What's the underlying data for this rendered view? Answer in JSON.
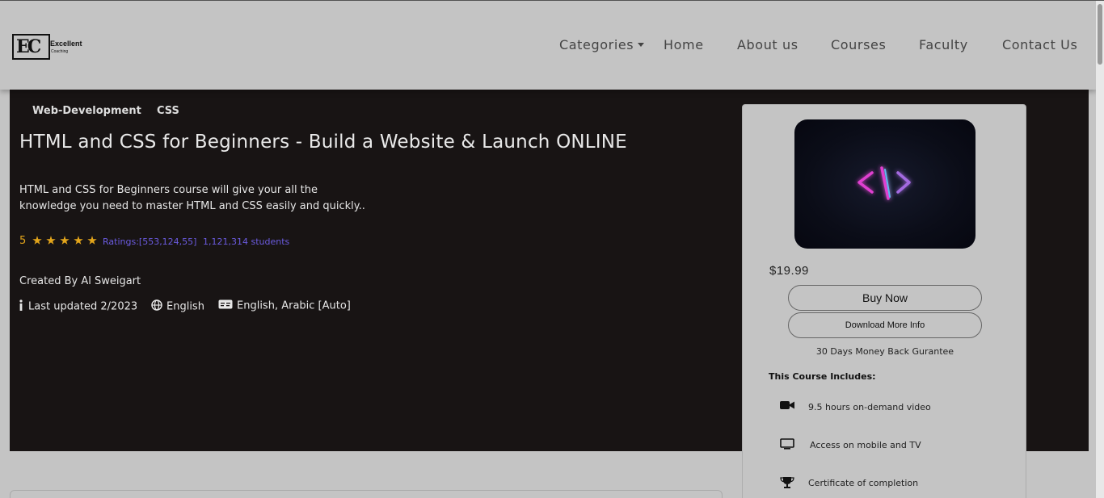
{
  "brand": {
    "logo_mark": "EC",
    "logo_title": "Excellent",
    "logo_subtitle": "Coaching"
  },
  "nav": {
    "categories": "Categories",
    "home": "Home",
    "about": "About us",
    "courses": "Courses",
    "faculty": "Faculty",
    "contact": "Contact Us"
  },
  "course": {
    "tags": [
      "Web-Development",
      "CSS"
    ],
    "title": "HTML and CSS for Beginners - Build a Website & Launch ONLINE",
    "description": "HTML and CSS for Beginners course will give your all the knowledge you need to master HTML and CSS easily and quickly..",
    "rating": "5",
    "stars": 5,
    "ratings_count": "Ratings:[553,124,55]",
    "students": "1,121,314 students",
    "creator": "Created By Al Sweigart",
    "last_updated": "Last updated 2/2023",
    "language": "English",
    "captions": "English, Arabic [Auto]"
  },
  "sidebar": {
    "thumbnail_icon": "code-brackets-icon",
    "price": "$19.99",
    "buy_label": "Buy Now",
    "info_label": "Download More Info",
    "guarantee": "30 Days Money Back Gurantee",
    "includes_title": "This Course Includes:",
    "includes": [
      {
        "icon": "video-camera-icon",
        "label": "9.5 hours on-demand video"
      },
      {
        "icon": "monitor-icon",
        "label": "Access on mobile and TV"
      },
      {
        "icon": "trophy-icon",
        "label": "Certificate of completion"
      }
    ]
  },
  "colors": {
    "page_bg": "#c4c4c4",
    "hero_bg": "#181414",
    "star": "#e3a51b",
    "link_purple": "#6b5be0",
    "neon_pink": "#e040d0",
    "neon_blue": "#5fb8f0"
  }
}
